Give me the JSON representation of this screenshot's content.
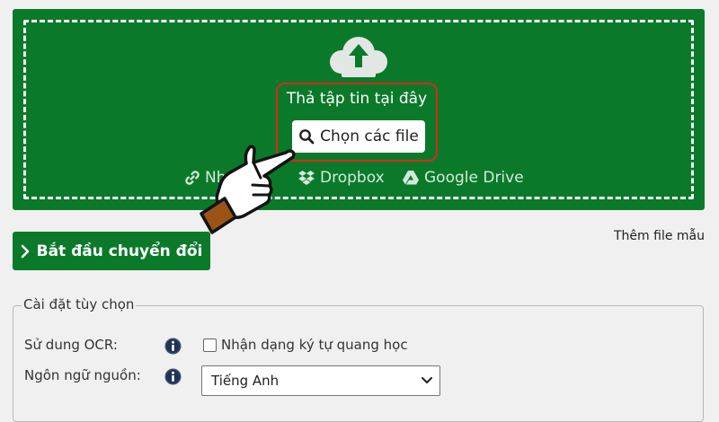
{
  "dropzone": {
    "drop_text": "Thả tập tin tại đây",
    "choose_button": "Chọn các file",
    "sources": [
      "Nh",
      "Dropbox",
      "Google Drive"
    ]
  },
  "actions": {
    "start_button": "Bắt đầu chuyển đổi",
    "sample_link": "Thêm file mẫu"
  },
  "options": {
    "legend": "Cài đặt tùy chọn",
    "ocr_label": "Sử dung OCR:",
    "ocr_checkbox_label": "Nhận dạng ký tự quang học",
    "ocr_checked": false,
    "language_label": "Ngôn ngữ nguồn:",
    "language_value": "Tiếng Anh"
  },
  "colors": {
    "brand_green": "#0a7a2a",
    "highlight_red": "#d9281f",
    "background": "#f0f0f0"
  },
  "icons": [
    "cloud-upload-icon",
    "search-icon",
    "link-icon",
    "dropbox-icon",
    "google-drive-icon",
    "chevron-right-icon",
    "info-icon",
    "chevron-down-icon",
    "pointing-hand-icon"
  ]
}
